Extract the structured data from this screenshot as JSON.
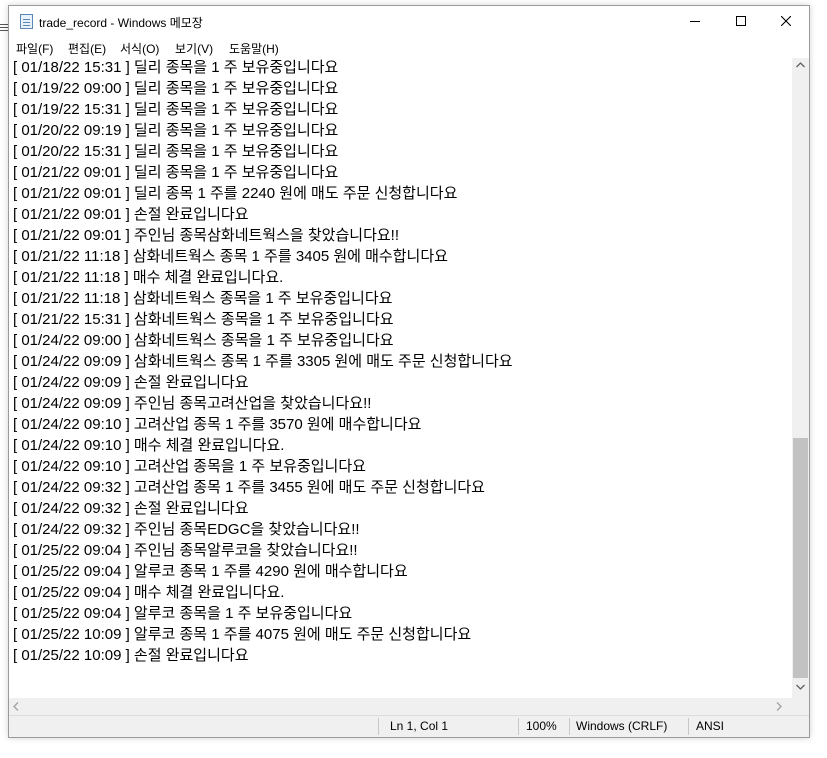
{
  "window": {
    "title": "trade_record - Windows 메모장"
  },
  "menu": [
    {
      "label": "파일(F)"
    },
    {
      "label": "편집(E)"
    },
    {
      "label": "서식(O)"
    },
    {
      "label": "보기(V)"
    },
    {
      "label": "도움말(H)"
    }
  ],
  "lines": [
    "[ 01/18/22 15:31 ] 딜리 종목을 1 주 보유중입니다요",
    "[ 01/19/22 09:00 ] 딜리 종목을 1 주 보유중입니다요",
    "[ 01/19/22 15:31 ] 딜리 종목을 1 주 보유중입니다요",
    "[ 01/20/22 09:19 ] 딜리 종목을 1 주 보유중입니다요",
    "[ 01/20/22 15:31 ] 딜리 종목을 1 주 보유중입니다요",
    "[ 01/21/22 09:01 ] 딜리 종목을 1 주 보유중입니다요",
    "[ 01/21/22 09:01 ] 딜리 종목 1 주를 2240 원에 매도 주문 신청합니다요",
    "[ 01/21/22 09:01 ] 손절 완료입니다요",
    "[ 01/21/22 09:01 ] 주인님 종목삼화네트웍스을 찾았습니다요!!",
    "[ 01/21/22 11:18 ] 삼화네트웍스 종목 1 주를 3405 원에 매수합니다요",
    "[ 01/21/22 11:18 ] 매수 체결 완료입니다요.",
    "[ 01/21/22 11:18 ] 삼화네트웍스 종목을 1 주 보유중입니다요",
    "[ 01/21/22 15:31 ] 삼화네트웍스 종목을 1 주 보유중입니다요",
    "[ 01/24/22 09:00 ] 삼화네트웍스 종목을 1 주 보유중입니다요",
    "[ 01/24/22 09:09 ] 삼화네트웍스 종목 1 주를 3305 원에 매도 주문 신청합니다요",
    "[ 01/24/22 09:09 ] 손절 완료입니다요",
    "[ 01/24/22 09:09 ] 주인님 종목고려산업을 찾았습니다요!!",
    "[ 01/24/22 09:10 ] 고려산업 종목 1 주를 3570 원에 매수합니다요",
    "[ 01/24/22 09:10 ] 매수 체결 완료입니다요.",
    "[ 01/24/22 09:10 ] 고려산업 종목을 1 주 보유중입니다요",
    "[ 01/24/22 09:32 ] 고려산업 종목 1 주를 3455 원에 매도 주문 신청합니다요",
    "[ 01/24/22 09:32 ] 손절 완료입니다요",
    "[ 01/24/22 09:32 ] 주인님 종목EDGC을 찾았습니다요!!",
    "[ 01/25/22 09:04 ] 주인님 종목알루코을 찾았습니다요!!",
    "[ 01/25/22 09:04 ] 알루코 종목 1 주를 4290 원에 매수합니다요",
    "[ 01/25/22 09:04 ] 매수 체결 완료입니다요.",
    "[ 01/25/22 09:04 ] 알루코 종목을 1 주 보유중입니다요",
    "[ 01/25/22 10:09 ] 알루코 종목 1 주를 4075 원에 매도 주문 신청합니다요",
    "[ 01/25/22 10:09 ] 손절 완료입니다요"
  ],
  "status": {
    "position": "Ln 1, Col 1",
    "zoom": "100%",
    "line_ending": "Windows (CRLF)",
    "encoding": "ANSI"
  },
  "icons": {
    "app": "notepad-icon",
    "minimize": "minimize-icon",
    "maximize": "maximize-icon",
    "close": "close-icon"
  }
}
